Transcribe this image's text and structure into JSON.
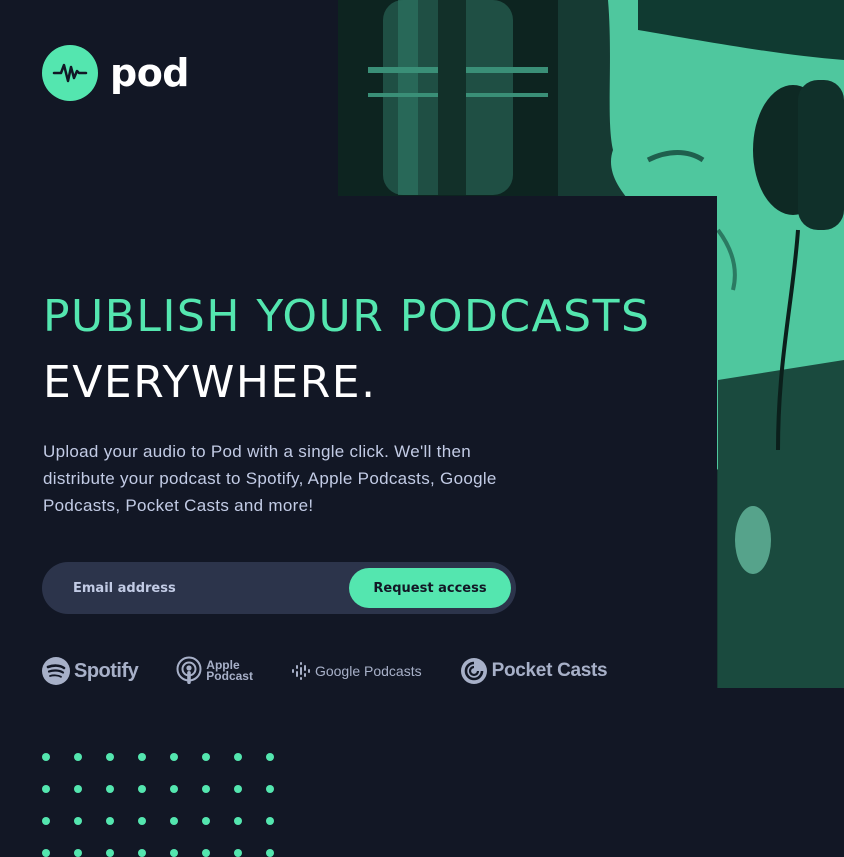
{
  "brand": {
    "name": "pod",
    "accent_color": "#54e6af",
    "background_color": "#121725"
  },
  "hero": {
    "headline_accent": "PUBLISH YOUR PODCASTS",
    "headline_plain": "EVERYWHERE.",
    "description": "Upload your audio to Pod with a single click. We'll then distribute your podcast to Spotify, Apple Podcasts, Google Podcasts, Pocket Casts and more!",
    "image_alt": "podcaster at microphone with headphones"
  },
  "signup": {
    "email_placeholder": "Email address",
    "submit_label": "Request access"
  },
  "platforms": [
    {
      "name": "Spotify",
      "icon": "spotify-icon"
    },
    {
      "name": "Apple\nPodcast",
      "icon": "apple-podcast-icon"
    },
    {
      "name": "Google Podcasts",
      "icon": "google-podcasts-icon"
    },
    {
      "name": "Pocket Casts",
      "icon": "pocket-casts-icon"
    }
  ]
}
